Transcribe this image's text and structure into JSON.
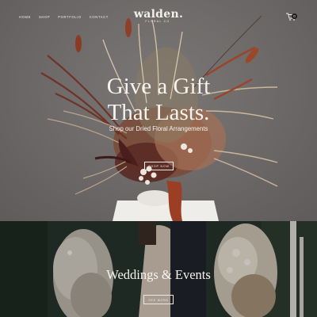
{
  "nav": {
    "items": [
      "HOME",
      "SHOP",
      "PORTFOLIO",
      "CONTACT"
    ]
  },
  "logo": {
    "main": "walden.",
    "sub": "FLORAL CO."
  },
  "cart": {
    "count": "0"
  },
  "hero": {
    "title_line1": "Give a Gift",
    "title_line2": "That Lasts.",
    "subtitle": "Shop our Dried Floral Arrangements",
    "button": "SHOP NOW"
  },
  "weddings": {
    "title": "Weddings & Events",
    "button": "SEE MORE"
  },
  "colors": {
    "hero_bg": "#6f6b6a",
    "text_light": "#f7f3ef",
    "rust": "#8a3b24",
    "wedding_bg": "#26302a"
  },
  "icons": [
    "cart-icon"
  ]
}
